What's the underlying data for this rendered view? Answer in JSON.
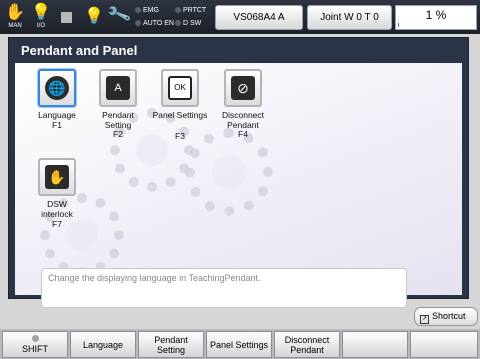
{
  "status_bar": {
    "mode_label": "MAN",
    "io_label": "I/O",
    "indicators": [
      "EMG",
      "PRTCT",
      "AUTO EN",
      "D SW"
    ],
    "robot_button": "VS068A4 A",
    "joint_button": "Joint  W 0 T 0",
    "speed_text": "1 %",
    "speed_fraction": 0.01
  },
  "panel": {
    "title": "Pendant and Panel",
    "functions": [
      {
        "label": "Language",
        "key": "F1",
        "icon": "globe-icon"
      },
      {
        "label": "Pendant Setting",
        "key": "F2",
        "icon": "pendant-setting-icon"
      },
      {
        "label": "Panel Settings",
        "key": "F3",
        "icon": "panel-settings-icon"
      },
      {
        "label": "Disconnect Pendant",
        "key": "F4",
        "icon": "disconnect-icon"
      },
      {
        "label": "DSW interlock",
        "key": "F7",
        "icon": "dsw-hand-icon"
      }
    ],
    "description": "Change the displaying language in TeachingPendant."
  },
  "shortcut_label": "Shortcut",
  "function_keys": [
    "SHIFT",
    "Language",
    "Pendant Setting",
    "Panel Settings",
    "Disconnect Pendant",
    "",
    ""
  ]
}
